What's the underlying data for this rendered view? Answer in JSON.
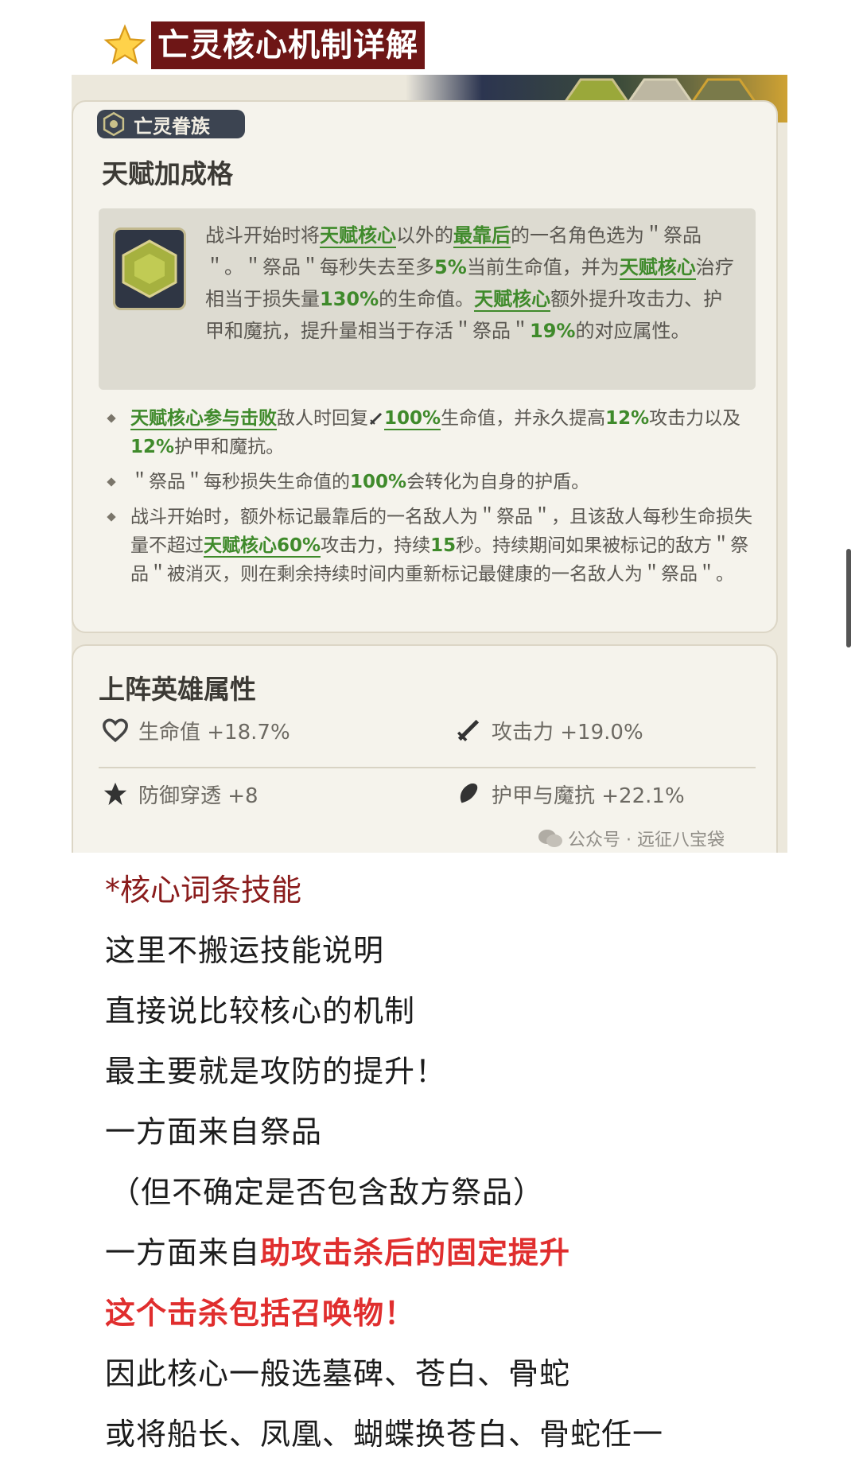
{
  "header": {
    "icon": "star-icon",
    "title": "亡灵核心机制详解"
  },
  "screenshot": {
    "faction_badge": "亡灵眷族",
    "talent_title": "天赋加成格",
    "description": {
      "part1": "战斗开始时将",
      "hl1": "天赋核心",
      "part2": "以外的",
      "hl2": "最靠后",
      "part3": "的一名角色选为＂祭品＂。＂祭品＂每秒失去至多",
      "hl3": "5%",
      "part4": "当前生命值，并为",
      "hl4": "天赋核心",
      "part5": "治疗相当于损失量",
      "hl5": "130%",
      "part6": "的生命值。",
      "hl6": "天赋核心",
      "part7": "额外提升攻击力、护甲和魔抗，提升量相当于存活＂祭品＂",
      "hl7": "19%",
      "part8": "的对应属性。"
    },
    "bullets": [
      {
        "hl1": "天赋核心参与击败",
        "t1": "敌人时回复",
        "icon": "sword-icon",
        "hl2": "100%",
        "t2": "生命值，并永久提高",
        "hl3": "12%",
        "t3": "攻击力以及",
        "hl4": "12%",
        "t4": "护甲和魔抗。"
      },
      {
        "t1": "＂祭品＂每秒损失生命值的",
        "hl1": "100%",
        "t2": "会转化为自身的护盾。"
      },
      {
        "t1": "战斗开始时，额外标记最靠后的一名敌人为＂祭品＂，且该敌人每秒生命损失量不超过",
        "hl1": "天赋核心60%",
        "t2": "攻击力，持续",
        "hl2": "15",
        "t3": "秒。持续期间如果被标记的敌方＂祭品＂被消灭，则在剩余持续时间内重新标记最健康的一名敌人为＂祭品＂。"
      }
    ],
    "attributes_title": "上阵英雄属性",
    "attributes": [
      {
        "icon": "heart-icon",
        "text": "生命值 +18.7%"
      },
      {
        "icon": "sword-icon",
        "text": "攻击力 +19.0%"
      },
      {
        "icon": "penetration-icon",
        "text": "防御穿透 +8"
      },
      {
        "icon": "shield-icon",
        "text": "护甲与魔抗 +22.1%"
      }
    ],
    "watermark": "公众号 · 远征八宝袋"
  },
  "article": {
    "heading": "*核心词条技能",
    "lines": [
      "这里不搬运技能说明",
      "直接说比较核心的机制",
      "最主要就是攻防的提升！",
      "一方面来自祭品",
      "（但不确定是否包含敌方祭品）"
    ],
    "line6_prefix": "一方面来自",
    "line6_highlight": "助攻击杀后的固定提升",
    "line7": "这个击杀包括召唤物！",
    "line8": "因此核心一般选墓碑、苍白、骨蛇",
    "line9": "或将船长、凤凰、蝴蝶换苍白、骨蛇任一"
  },
  "colors": {
    "title_bg": "#6e1616",
    "highlight_green": "#3f8a2b",
    "heading_red": "#8a1c1c",
    "emphasis_red": "#e02e2e"
  }
}
